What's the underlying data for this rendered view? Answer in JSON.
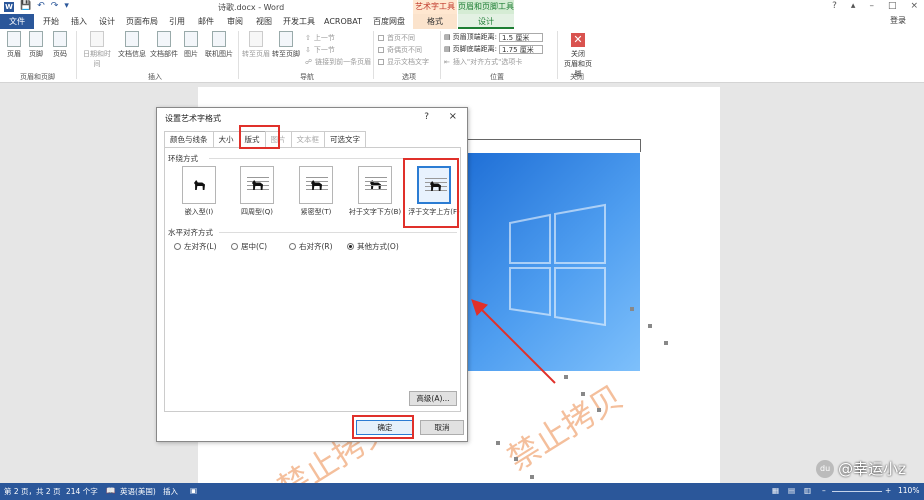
{
  "window": {
    "app_icon": "W",
    "title": "诗歌.docx - Word",
    "context_groups": [
      "艺术字工具",
      "页眉和页脚工具"
    ],
    "controls": [
      "?",
      "–",
      "□",
      "×"
    ],
    "login": "登录"
  },
  "tabs": [
    "文件",
    "开始",
    "插入",
    "设计",
    "页面布局",
    "引用",
    "邮件",
    "审阅",
    "视图",
    "开发工具",
    "ACROBAT",
    "百度网盘",
    "格式",
    "设计"
  ],
  "ribbon": {
    "groups": {
      "header_footer": {
        "buttons": [
          "页眉",
          "页脚",
          "页码"
        ],
        "label": "页眉和页脚"
      },
      "insert": {
        "buttons": [
          "日期和时间",
          "文档信息",
          "文档部件",
          "图片",
          "联机图片"
        ],
        "label": "插入"
      },
      "navigation": {
        "buttons": [
          "转至页眉",
          "转至页脚"
        ],
        "small": [
          "上一节",
          "下一节",
          "链接到前一条页眉"
        ],
        "label": "导航"
      },
      "options": {
        "items": [
          "首页不同",
          "奇偶页不同",
          "显示文档文字"
        ],
        "label": "选项"
      },
      "position": {
        "header_label": "页眉顶端距离:",
        "header_value": "1.5 厘米",
        "footer_label": "页脚底端距离:",
        "footer_value": "1.75 厘米",
        "align_tab": "插入\"对齐方式\"选项卡",
        "label": "位置"
      },
      "close": {
        "button": "关闭\n页眉和页脚",
        "label": "关闭"
      }
    }
  },
  "dialog": {
    "title": "设置艺术字格式",
    "help": "?",
    "close": "×",
    "tabs": [
      "颜色与线条",
      "大小",
      "版式",
      "图片",
      "文本框",
      "可选文字"
    ],
    "wrap_section": "环绕方式",
    "wrap_options": [
      "嵌入型(I)",
      "四周型(Q)",
      "紧密型(T)",
      "衬于文字下方(B)",
      "浮于文字上方(F)"
    ],
    "wrap_selected": 4,
    "halign_section": "水平对齐方式",
    "halign_options": [
      "左对齐(L)",
      "居中(C)",
      "右对齐(R)",
      "其他方式(O)"
    ],
    "halign_selected": 3,
    "advanced_button": "高级(A)...",
    "ok_button": "确定",
    "cancel_button": "取消"
  },
  "document": {
    "watermark": "禁止拷贝"
  },
  "statusbar": {
    "page": "第 2 页，共 2 页",
    "words": "214 个字",
    "lang": "英语(美国)",
    "mode": "插入",
    "zoom": "110%"
  },
  "brand": {
    "badge": "du",
    "text": "@幸运小z"
  },
  "colors": {
    "word_blue": "#2b579a",
    "highlight_red": "#e0302a",
    "watermark_orange": "#f3b48b",
    "selected_blue": "#2b7cd3"
  }
}
